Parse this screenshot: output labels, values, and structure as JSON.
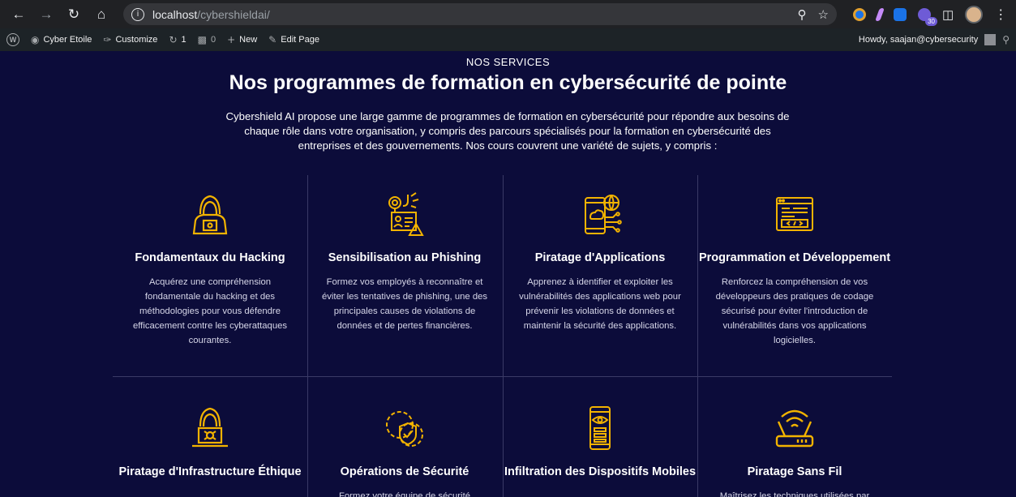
{
  "browser": {
    "url_host": "localhost",
    "url_path": "/cybershieldai/",
    "extension_badge": "30"
  },
  "adminbar": {
    "site_name": "Cyber Etoile",
    "customize": "Customize",
    "updates_count": "1",
    "comments_count": "0",
    "new_label": "New",
    "edit_page": "Edit Page",
    "howdy": "Howdy, saajan@cybersecurity"
  },
  "section": {
    "eyebrow": "NOS SERVICES",
    "heading": "Nos programmes de formation en cybersécurité de pointe",
    "intro": "Cybershield AI propose une large gamme de programmes de formation en cybersécurité pour répondre aux besoins de chaque rôle dans votre organisation, y compris des parcours spécialisés pour la formation en cybersécurité des entreprises et des gouvernements. Nos cours couvrent une variété de sujets, y compris :"
  },
  "accent_color": "#f2b300",
  "services": [
    {
      "icon": "hacker-icon",
      "title": "Fondamentaux du Hacking",
      "desc": "Acquérez une compréhension fondamentale du hacking et des méthodologies pour vous défendre efficacement contre les cyberattaques courantes."
    },
    {
      "icon": "phishing-icon",
      "title": "Sensibilisation au Phishing",
      "desc": "Formez vos employés à reconnaître et éviter les tentatives de phishing, une des principales causes de violations de données et de pertes financières."
    },
    {
      "icon": "mobile-app-icon",
      "title": "Piratage d'Applications",
      "desc": "Apprenez à identifier et exploiter les vulnérabilités des applications web pour prévenir les violations de données et maintenir la sécurité des applications."
    },
    {
      "icon": "code-window-icon",
      "title": "Programmation et Développement",
      "desc": "Renforcez la compréhension de vos développeurs des pratiques de codage sécurisé pour éviter l'introduction de vulnérabilités dans vos applications logicielles."
    },
    {
      "icon": "hacker-laptop-icon",
      "title": "Piratage d'Infrastructure Éthique",
      "desc": ""
    },
    {
      "icon": "shield-gears-icon",
      "title": "Opérations de Sécurité",
      "desc": "Formez votre équipe de sécurité"
    },
    {
      "icon": "smartphone-eye-icon",
      "title": "Infiltration des Dispositifs Mobiles",
      "desc": ""
    },
    {
      "icon": "wifi-router-icon",
      "title": "Piratage Sans Fil",
      "desc": "Maîtrisez les techniques utilisées par"
    }
  ]
}
